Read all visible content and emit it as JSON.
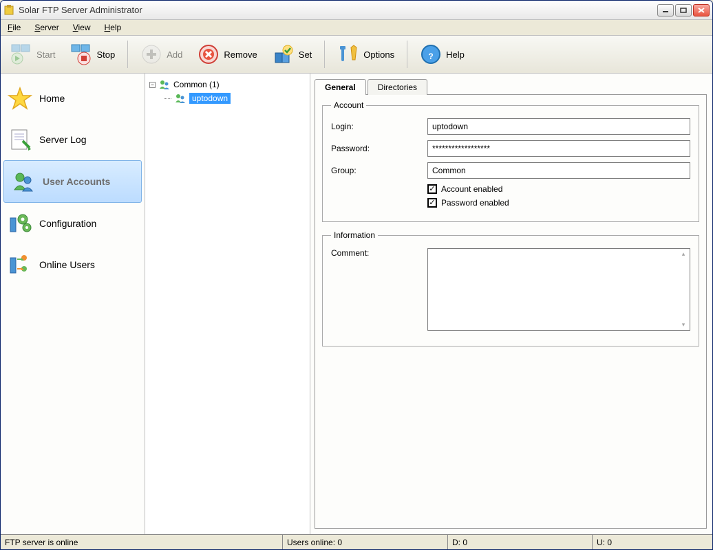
{
  "window": {
    "title": "Solar FTP Server Administrator"
  },
  "menubar": {
    "file": "File",
    "server": "Server",
    "view": "View",
    "help": "Help"
  },
  "toolbar": {
    "start": "Start",
    "stop": "Stop",
    "add": "Add",
    "remove": "Remove",
    "set": "Set",
    "options": "Options",
    "help": "Help"
  },
  "sidebar": {
    "items": [
      {
        "label": "Home"
      },
      {
        "label": "Server Log"
      },
      {
        "label": "User Accounts"
      },
      {
        "label": "Configuration"
      },
      {
        "label": "Online Users"
      }
    ]
  },
  "tree": {
    "group": "Common (1)",
    "user": "uptodown"
  },
  "tabs": {
    "general": "General",
    "directories": "Directories"
  },
  "account": {
    "legend": "Account",
    "login_label": "Login:",
    "login_value": "uptodown",
    "password_label": "Password:",
    "password_value": "******************",
    "group_label": "Group:",
    "group_value": "Common",
    "account_enabled_label": "Account enabled",
    "account_enabled": true,
    "password_enabled_label": "Password enabled",
    "password_enabled": true
  },
  "information": {
    "legend": "Information",
    "comment_label": "Comment:",
    "comment_value": ""
  },
  "statusbar": {
    "server_status": "FTP server is online",
    "users_online": "Users online: 0",
    "d": "D: 0",
    "u": "U: 0"
  }
}
